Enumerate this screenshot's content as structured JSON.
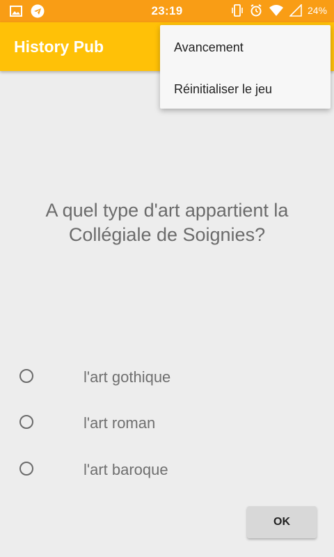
{
  "status_bar": {
    "time": "23:19",
    "battery": "24%",
    "bg_color": "#f99d15",
    "left_icons": [
      "image-icon",
      "telegram-icon"
    ],
    "right_icons": [
      "vibrate-icon",
      "alarm-icon",
      "wifi-icon",
      "signal-icon"
    ]
  },
  "app_bar": {
    "title": "History Pub",
    "bg_color": "#ffc107"
  },
  "menu": {
    "items": [
      {
        "label": "Avancement"
      },
      {
        "label": "Réinitialiser le jeu"
      }
    ]
  },
  "question": {
    "text": "A quel type d'art appartient la Collégiale de Soignies?"
  },
  "options": [
    {
      "label": "l'art gothique",
      "selected": false
    },
    {
      "label": "l'art roman",
      "selected": false
    },
    {
      "label": "l'art baroque",
      "selected": false
    }
  ],
  "ok_button": {
    "label": "OK"
  }
}
